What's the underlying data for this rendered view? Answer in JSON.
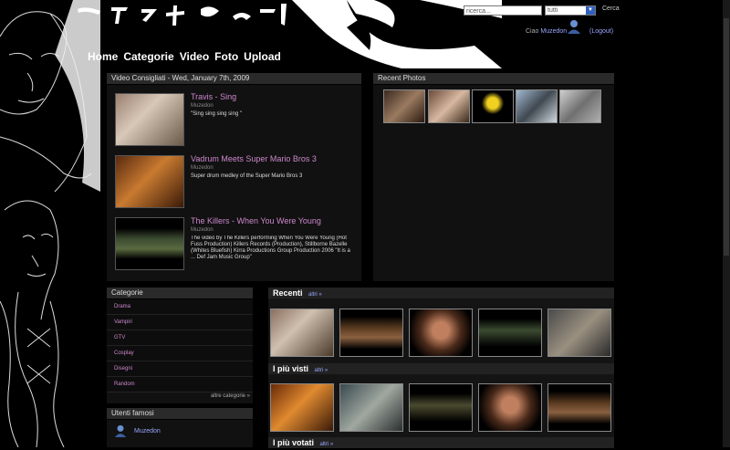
{
  "header": {
    "glyph_banner": "decorative-glyph-banner",
    "search": {
      "value": "ricerca..."
    },
    "search_type": {
      "selected": "tutti"
    },
    "search_button": "Cerca",
    "user_greeting": "Ciao",
    "user_name": "Muzedon",
    "logout": "(Logout)"
  },
  "nav": {
    "items": [
      "Home",
      "Categorie",
      "Video",
      "Foto",
      "Upload"
    ]
  },
  "featured": {
    "title": "Video Consigliati - Wed, January 7th, 2009",
    "items": [
      {
        "title": "Travis - Sing",
        "user": "Muzedon",
        "desc": "\"Sing sing sing sing \""
      },
      {
        "title": "Vadrum Meets Super Mario Bros 3",
        "user": "Muzedon",
        "desc": "Super drum medley of the Super Mario Bros 3"
      },
      {
        "title": "The Killers - When You Were Young",
        "user": "Muzedon",
        "desc": "The video by The Killers performing When You Were Young (Hot Fuss Production) Killers Records (Production), Stillborne Bazelle (Whites Bluefish) Kirra Productions Group Production 2006 \"It is a ... Def Jam Music Group\""
      }
    ]
  },
  "recent_photos": {
    "title": "Recent Photos",
    "count": 5
  },
  "categories": {
    "title": "Categorie",
    "items": [
      "Drama",
      "Vampiri",
      "GTV",
      "Cosplay",
      "Disegni",
      "Random"
    ],
    "more": "altre categorie »"
  },
  "famous_users": {
    "title": "Utenti famosi",
    "items": [
      "Muzedon"
    ]
  },
  "sections": [
    {
      "title": "Recenti",
      "more": "altri »"
    },
    {
      "title": "I più visti",
      "more": "altri »"
    },
    {
      "title": "I più votati",
      "more": "altri »"
    }
  ],
  "colors": {
    "accent": "#cc88cc",
    "link": "#9aa7ff",
    "panel": "#111111",
    "bar": "#2a2a2a"
  }
}
